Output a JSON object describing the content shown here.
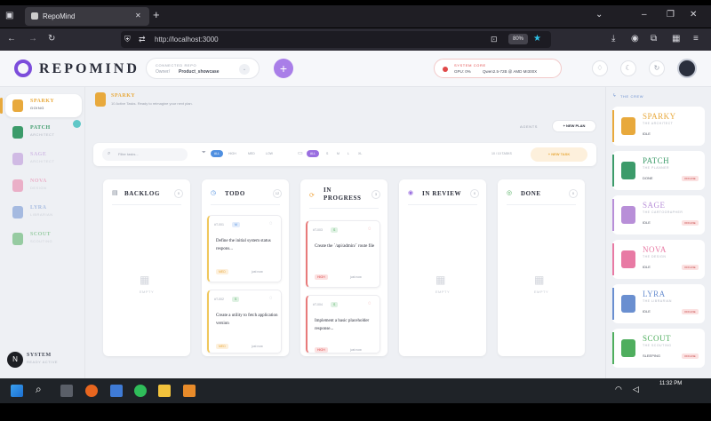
{
  "browser": {
    "tab_title": "RepoMind",
    "url": "http://localhost:3000",
    "zoom": "80%"
  },
  "header": {
    "logo": "REPOMIND",
    "connected_label": "CONNECTED REPO",
    "repo_prefix": "Owner/",
    "repo_name": "Product_showcase",
    "system_label": "SYSTEM CORE",
    "gpu": "GPU: 0%",
    "model": "Qwen2.5-72B @ AMD MI300X"
  },
  "sidebar": {
    "items": [
      {
        "name": "SPARKY",
        "sub": "GOING",
        "color": "#e8a93c",
        "active": true
      },
      {
        "name": "PATCH",
        "sub": "ARCHITECT",
        "color": "#3c9b6a",
        "active": false
      },
      {
        "name": "SAGE",
        "sub": "ARCHITECT",
        "color": "#b88fd8",
        "active": false
      },
      {
        "name": "NOVA",
        "sub": "DESIGN",
        "color": "#e87aa4",
        "active": false
      },
      {
        "name": "LYRA",
        "sub": "LIBRARIAN",
        "color": "#6a8fd0",
        "active": false
      },
      {
        "name": "SCOUT",
        "sub": "SCOUTING",
        "color": "#4fae5e",
        "active": false
      }
    ],
    "system_label": "SYSTEM",
    "system_sub": "READY ACTIVE",
    "avatar_letter": "N"
  },
  "main": {
    "agent_name": "SPARKY",
    "agent_desc": "10 Active Tasks. Ready to reimagine your next plan.",
    "agents_label": "AGENTS",
    "new_plan": "+ NEW PLAN",
    "filter_placeholder": "Filter tasks...",
    "priority_filters": [
      "ALL",
      "HIGH",
      "MED",
      "LOW"
    ],
    "size_filters": [
      "ALL",
      "S",
      "M",
      "L",
      "XL"
    ],
    "task_count": "10 / 10 TASKS",
    "new_task": "+ NEW TASK",
    "columns": [
      {
        "title": "BACKLOG",
        "count": "0",
        "color": "#7d8594"
      },
      {
        "title": "TODO",
        "count": "12",
        "color": "#4f8fe0"
      },
      {
        "title": "IN PROGRESS",
        "count": "3",
        "color": "#f0a640"
      },
      {
        "title": "IN REVIEW",
        "count": "0",
        "color": "#9a6ee0"
      },
      {
        "title": "DONE",
        "count": "0",
        "color": "#4fae5e"
      }
    ],
    "empty_label": "EMPTY",
    "tasks": {
      "todo": [
        {
          "id": "#T-001",
          "size": "M",
          "title": "Define the initial system status respons...",
          "priority": "MED",
          "status": "just now"
        },
        {
          "id": "#T-002",
          "size": "S",
          "title": "Create a utility to fetch application version",
          "priority": "MED",
          "status": "just now"
        }
      ],
      "in_progress": [
        {
          "id": "#T-003",
          "size": "S",
          "title": "Create the `/api/admin/` route file",
          "priority": "HIGH",
          "status": "just now"
        },
        {
          "id": "#T-004",
          "size": "S",
          "title": "Implement a basic placeholder response...",
          "priority": "HIGH",
          "status": "just now"
        }
      ]
    }
  },
  "crew": {
    "label": "THE CREW",
    "members": [
      {
        "name": "SPARKY",
        "role": "THE ARCHITECT",
        "status": "IDLE",
        "color": "#e8a93c",
        "badge": ""
      },
      {
        "name": "PATCH",
        "role": "THE PLANNER",
        "status": "DONE",
        "color": "#3c9b6a",
        "badge": "OFFLINE"
      },
      {
        "name": "SAGE",
        "role": "THE CARTOGRAPHER",
        "status": "IDLE",
        "color": "#b88fd8",
        "badge": "OFFLINE"
      },
      {
        "name": "NOVA",
        "role": "THE DESIGN",
        "status": "IDLE",
        "color": "#e87aa4",
        "badge": "OFFLINE"
      },
      {
        "name": "LYRA",
        "role": "THE LIBRARIAN",
        "status": "IDLE",
        "color": "#6a8fd0",
        "badge": "OFFLINE"
      },
      {
        "name": "SCOUT",
        "role": "THE SCOUTING",
        "status": "SLEEPING",
        "color": "#4fae5e",
        "badge": "OFFLINE"
      }
    ]
  },
  "taskbar": {
    "time": "11:32 PM"
  }
}
